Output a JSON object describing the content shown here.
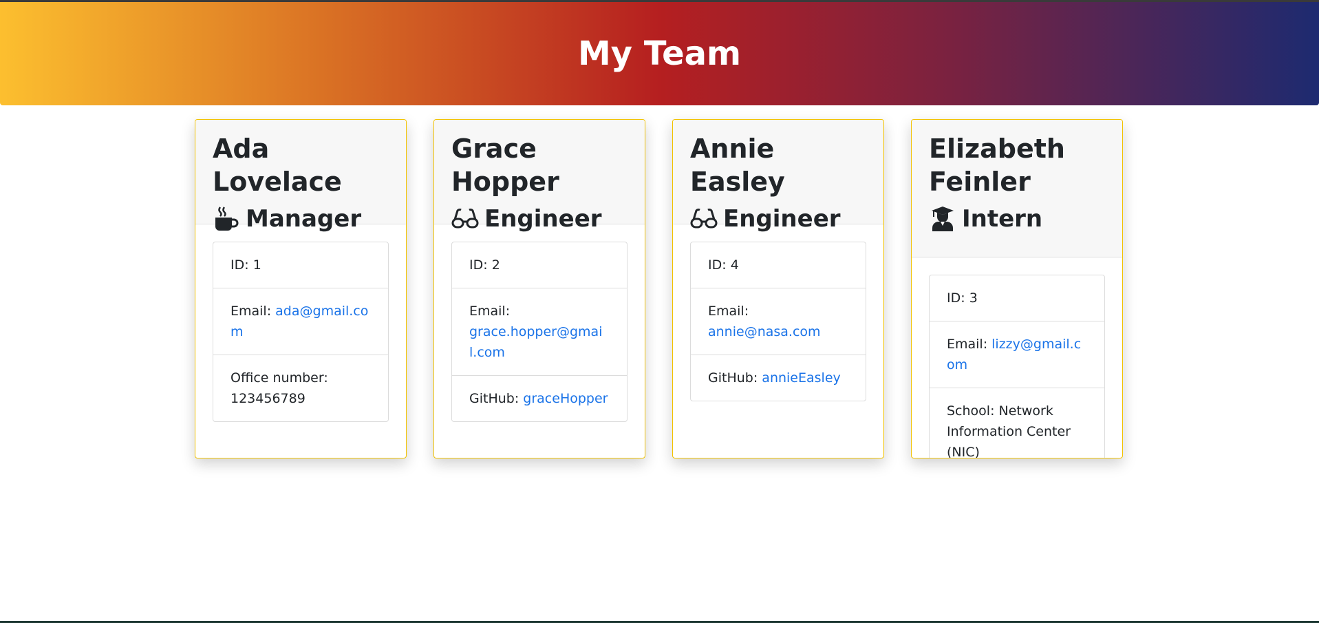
{
  "header": {
    "title": "My Team"
  },
  "colors": {
    "gradient_start": "#fcbf2f",
    "gradient_mid": "#b51f20",
    "gradient_end": "#1d2a70",
    "card_border": "#f2c200",
    "link": "#1a73e8"
  },
  "employees": [
    {
      "name": "Ada Lovelace",
      "role": "Manager",
      "icon": "coffee-mug-icon",
      "id_label": "ID: ",
      "id": "1",
      "email_label": "Email: ",
      "email": "ada@gmail.com",
      "extra_label": "Office number: ",
      "extra_value": "123456789"
    },
    {
      "name": "Grace Hopper",
      "role": "Engineer",
      "icon": "glasses-icon",
      "id_label": "ID: ",
      "id": "2",
      "email_label": "Email: ",
      "email": "grace.hopper@gmail.com",
      "extra_label": "GitHub: ",
      "extra_value": "graceHopper"
    },
    {
      "name": "Annie Easley",
      "role": "Engineer",
      "icon": "glasses-icon",
      "id_label": "ID: ",
      "id": "4",
      "email_label": "Email: ",
      "email": "annie@nasa.com",
      "extra_label": "GitHub: ",
      "extra_value": "annieEasley"
    },
    {
      "name": "Elizabeth Feinler",
      "role": "Intern",
      "icon": "graduate-icon",
      "id_label": "ID: ",
      "id": "3",
      "email_label": "Email: ",
      "email": "lizzy@gmail.com",
      "extra_label": "School: ",
      "extra_value": "Network Information Center (NIC)"
    }
  ]
}
